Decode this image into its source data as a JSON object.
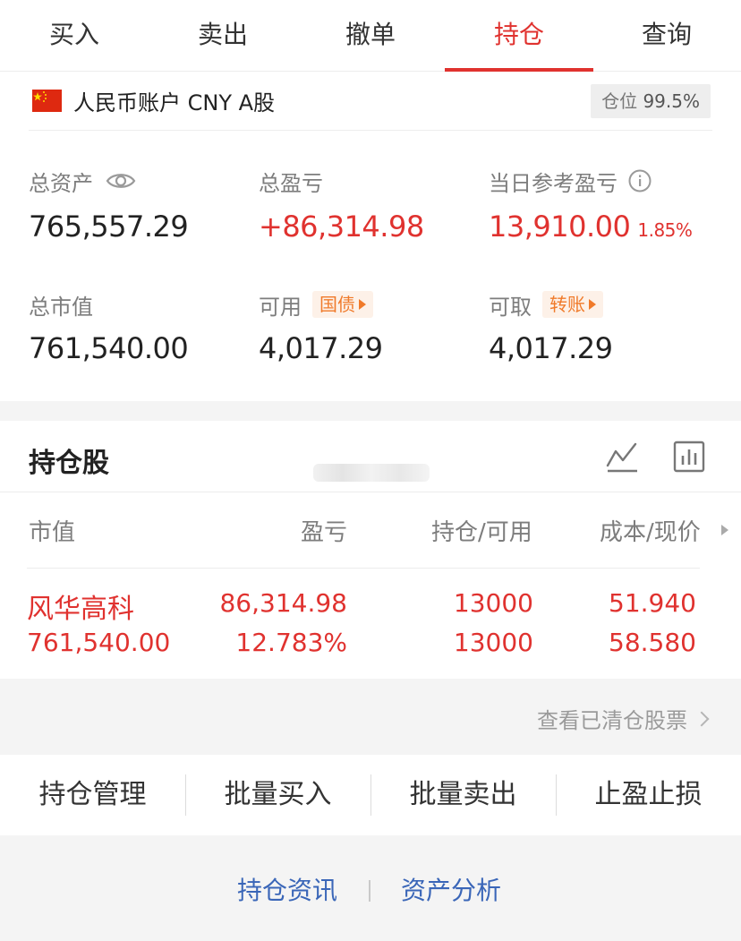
{
  "tabs": [
    {
      "label": "买入",
      "active": false
    },
    {
      "label": "卖出",
      "active": false
    },
    {
      "label": "撤单",
      "active": false
    },
    {
      "label": "持仓",
      "active": true
    },
    {
      "label": "查询",
      "active": false
    }
  ],
  "account": {
    "flag_icon": "china-flag-icon",
    "name": "人民币账户 CNY A股",
    "position_label": "仓位",
    "position_value": "99.5%"
  },
  "stats": {
    "total_assets": {
      "label": "总资产",
      "value": "765,557.29",
      "icon": "eye-icon"
    },
    "total_pnl": {
      "label": "总盈亏",
      "value": "+86,314.98"
    },
    "daily_pnl": {
      "label": "当日参考盈亏",
      "value": "13,910.00",
      "percent": "1.85%",
      "icon": "info-icon"
    },
    "market_value": {
      "label": "总市值",
      "value": "761,540.00"
    },
    "available": {
      "label": "可用",
      "tag": "国债",
      "value": "4,017.29"
    },
    "withdrawable": {
      "label": "可取",
      "tag": "转账",
      "value": "4,017.29"
    }
  },
  "holdings": {
    "title": "持仓股",
    "columns": [
      "市值",
      "盈亏",
      "持仓/可用",
      "成本/现价"
    ],
    "rows": [
      {
        "name": "风华高科",
        "market_value": "761,540.00",
        "pnl": "86,314.98",
        "pnl_pct": "12.783%",
        "position": "13000",
        "available": "13000",
        "cost": "51.940",
        "price": "58.580"
      }
    ]
  },
  "cleared_link": "查看已清仓股票",
  "actions": [
    "持仓管理",
    "批量买入",
    "批量卖出",
    "止盈止损"
  ],
  "links": [
    "持仓资讯",
    "资产分析"
  ],
  "colors": {
    "accent": "#e0322f",
    "tag": "#f07a2a",
    "link": "#3a66b8"
  }
}
